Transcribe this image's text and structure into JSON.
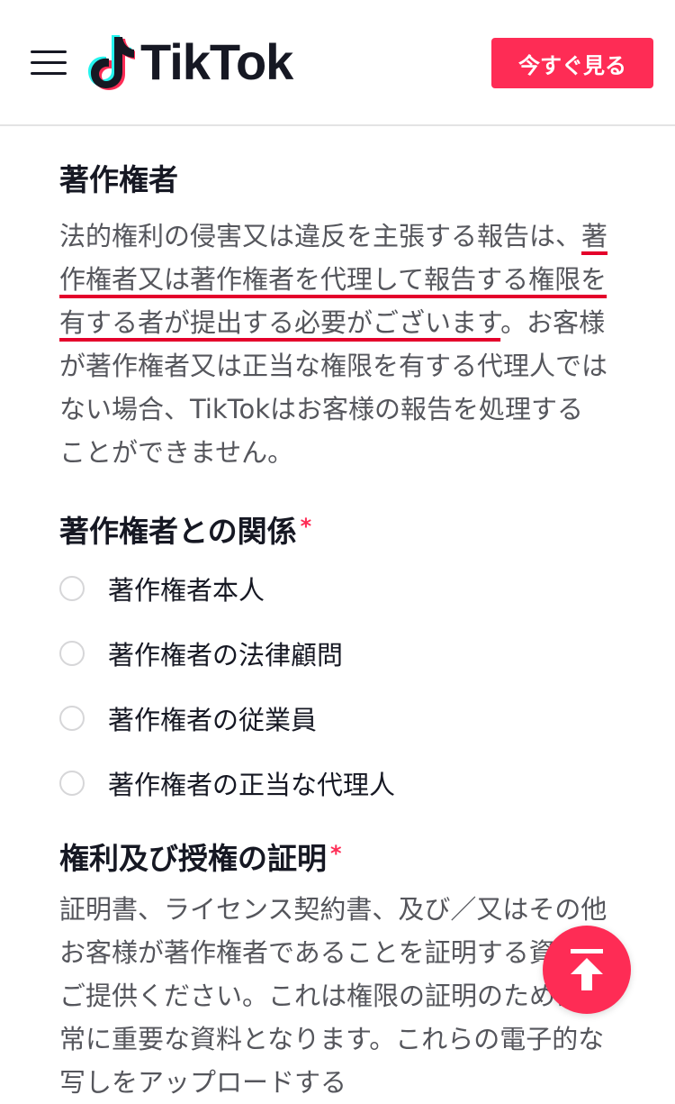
{
  "header": {
    "logo_text": "TikTok",
    "cta_label": "今すぐ見る"
  },
  "section_owner": {
    "title": "著作権者",
    "para_pre": "法的権利の侵害又は違反を主張する報告は、",
    "para_underlined": "著作権者又は著作権者を代理して報告する権限を有する者が提出する必要がございます",
    "para_post": "。お客様が著作権者又は正当な権限を有する代理人ではない場合、TikTokはお客様の報告を処理することができません。"
  },
  "relationship": {
    "title": "著作権者との関係",
    "required_mark": "*",
    "options": [
      {
        "label": "著作権者本人"
      },
      {
        "label": "著作権者の法律顧問"
      },
      {
        "label": "著作権者の従業員"
      },
      {
        "label": "著作権者の正当な代理人"
      }
    ]
  },
  "proof": {
    "title": "権利及び授権の証明",
    "required_mark": "*",
    "text": "証明書、ライセンス契約書、及び／又はその他お客様が著作権者であることを証明する資料をご提供ください。これは権限の証明のために非常に重要な資料となります。これらの電子的な写しをアップロードする"
  },
  "colors": {
    "accent": "#fe2c55",
    "underline": "#e4002b",
    "text": "#161823",
    "body_text": "#55565c"
  },
  "icons": {
    "menu": "hamburger-icon",
    "logo": "tiktok-note-icon",
    "to_top": "arrow-up-to-line-icon"
  }
}
